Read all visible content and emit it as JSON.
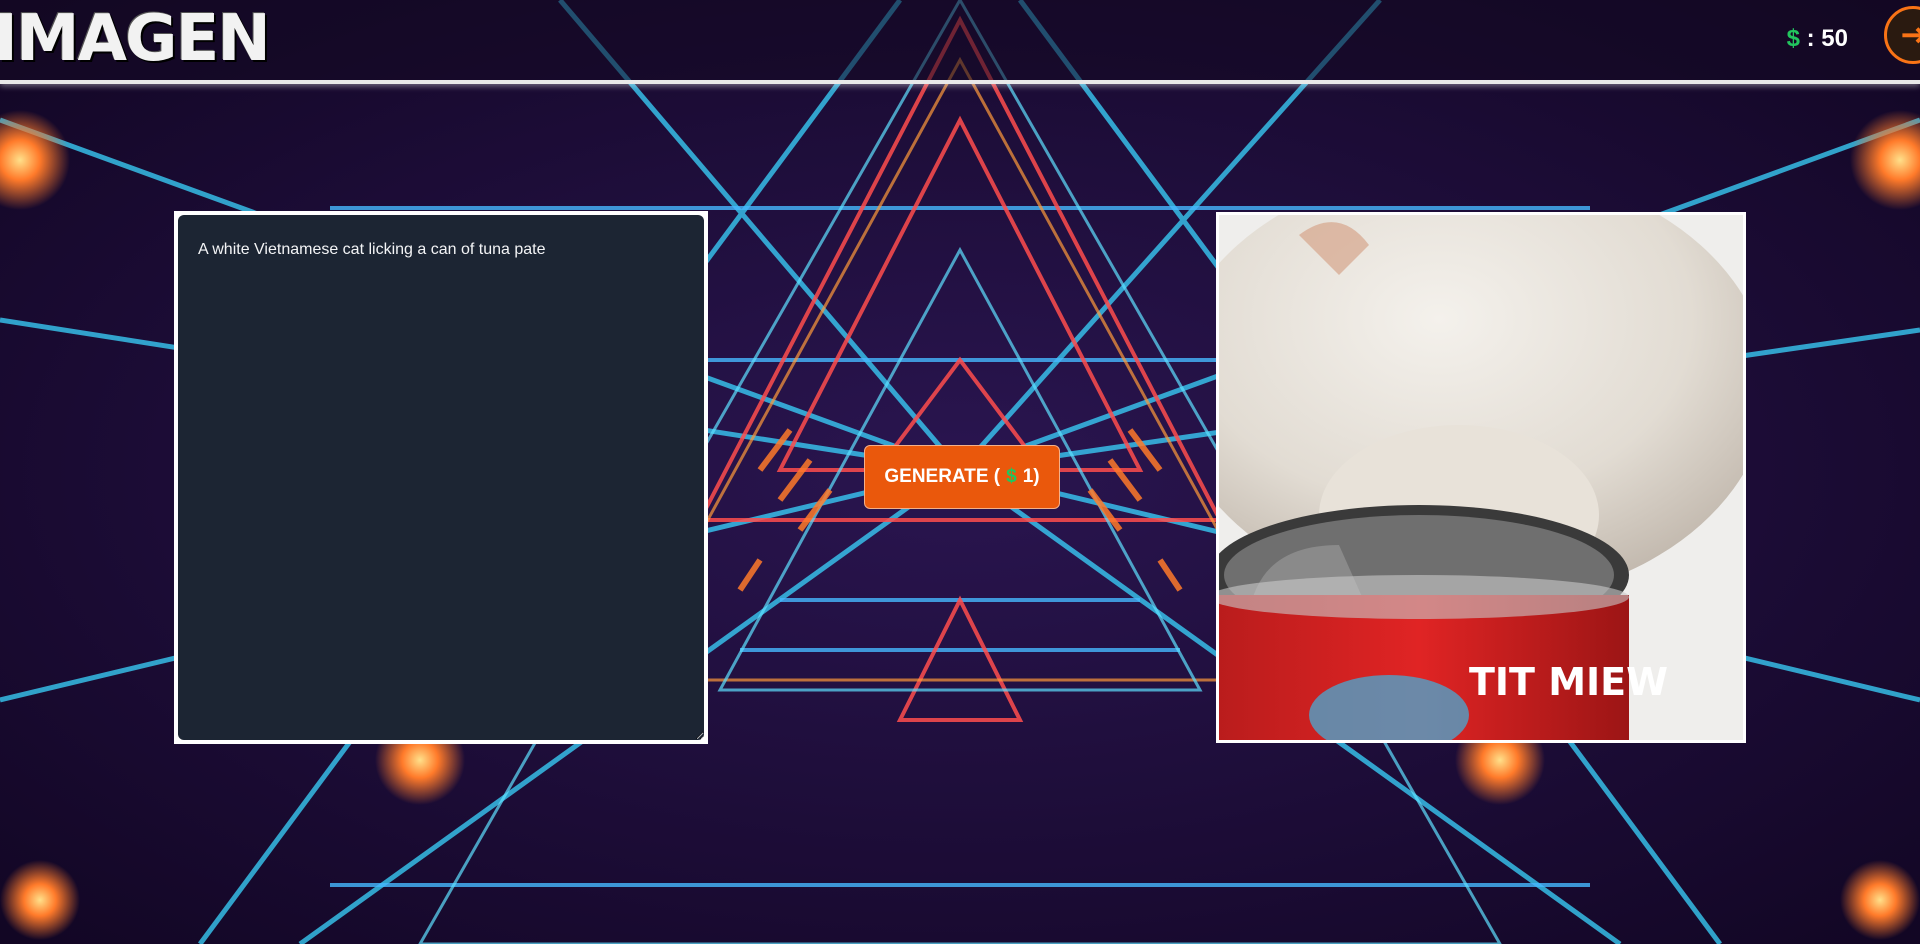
{
  "header": {
    "logo_text": "IMAGEN",
    "credits_symbol": "$",
    "credits_text": " : 50"
  },
  "prompt": {
    "value": "A white Vietnamese cat licking a can of tuna pate"
  },
  "generate_button": {
    "label_prefix": "GENERATE (",
    "symbol": "$",
    "label_suffix": "1)"
  },
  "output": {
    "can_label_text": "TIT MIEW"
  },
  "colors": {
    "accent": "#ea580c",
    "dollar": "#22c55e",
    "textarea_bg": "#1c2533"
  },
  "icons": {
    "exit": "logout-icon",
    "currency": "dollar-icon"
  }
}
